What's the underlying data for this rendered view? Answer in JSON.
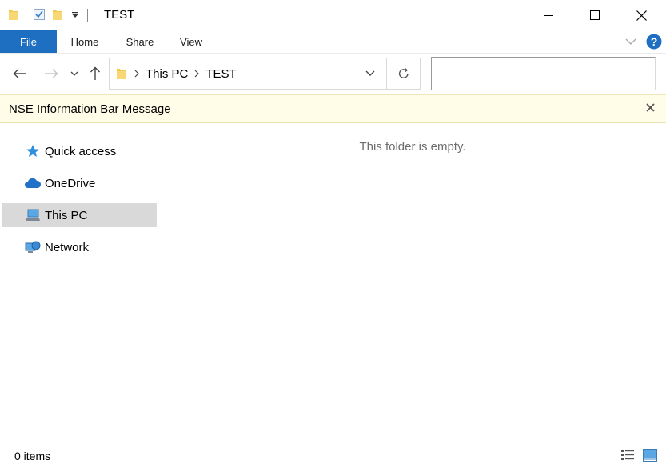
{
  "window": {
    "title": "TEST"
  },
  "ribbon": {
    "tabs": [
      {
        "label": "File"
      },
      {
        "label": "Home"
      },
      {
        "label": "Share"
      },
      {
        "label": "View"
      }
    ]
  },
  "address": {
    "crumbs": [
      "This PC",
      "TEST"
    ],
    "search_value": ""
  },
  "infobar": {
    "message": "NSE Information Bar Message",
    "close_glyph": "x"
  },
  "navpane": {
    "items": [
      {
        "label": "Quick access",
        "icon": "star-icon"
      },
      {
        "label": "OneDrive",
        "icon": "cloud-icon"
      },
      {
        "label": "This PC",
        "icon": "computer-icon",
        "selected": true
      },
      {
        "label": "Network",
        "icon": "network-icon"
      }
    ]
  },
  "content": {
    "empty_message": "This folder is empty."
  },
  "statusbar": {
    "item_count": "0 items"
  },
  "colors": {
    "accent": "#1e6fc1",
    "infobar_bg": "#fffde7",
    "selected_bg": "#d9d9d9",
    "help": "#1e6fc1"
  }
}
